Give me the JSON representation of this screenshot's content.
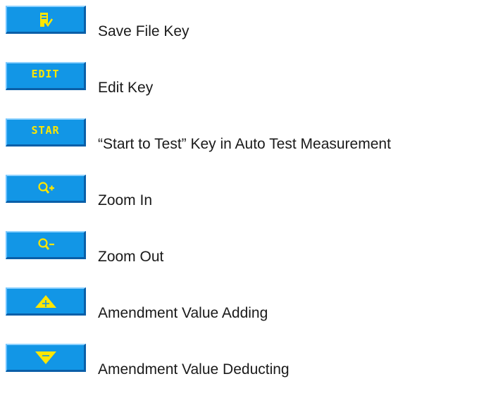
{
  "keys": [
    {
      "icon": "save-file-icon",
      "label": "Save File Key"
    },
    {
      "icon": "",
      "key_text": "EDIT",
      "label": "Edit Key"
    },
    {
      "icon": "",
      "key_text": "STAR",
      "label": "“Start to Test” Key in Auto Test Measurement"
    },
    {
      "icon": "zoom-in-icon",
      "label": "Zoom In"
    },
    {
      "icon": "zoom-out-icon",
      "label": "Zoom Out"
    },
    {
      "icon": "triangle-up-plus-icon",
      "label": "Amendment Value Adding"
    },
    {
      "icon": "triangle-down-minus-icon",
      "label": "Amendment Value Deducting"
    }
  ],
  "colors": {
    "key_fill": "#1296e6",
    "key_glyph": "#ffe600",
    "text": "#1a1a1a"
  }
}
